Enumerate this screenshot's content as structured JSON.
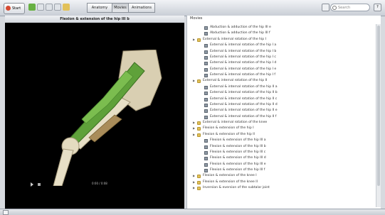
{
  "toolbar": {
    "start_label": "Start",
    "tabs": [
      {
        "label": "Anatomy",
        "active": false
      },
      {
        "label": "Movies",
        "active": true
      },
      {
        "label": "Animations",
        "active": false
      }
    ],
    "search_placeholder": "Search",
    "right_button": "?"
  },
  "left": {
    "title": "Flexion & extension of the hip III b",
    "video_time": "0:00 / 0:08"
  },
  "right": {
    "title": "Movies",
    "items": [
      {
        "label": "Abduction & adduction of the hip III e",
        "type": "item",
        "level": 1
      },
      {
        "label": "Abduction & adduction of the hip III f",
        "type": "item",
        "level": 1
      },
      {
        "label": "External & internal rotation of the hip I",
        "type": "folder",
        "level": 0
      },
      {
        "label": "External & internal rotation of the hip I a",
        "type": "item",
        "level": 1
      },
      {
        "label": "External & internal rotation of the hip I b",
        "type": "item",
        "level": 1
      },
      {
        "label": "External & internal rotation of the hip I c",
        "type": "item",
        "level": 1
      },
      {
        "label": "External & internal rotation of the hip I d",
        "type": "item",
        "level": 1
      },
      {
        "label": "External & internal rotation of the hip I e",
        "type": "item",
        "level": 1
      },
      {
        "label": "External & internal rotation of the hip I f",
        "type": "item",
        "level": 1
      },
      {
        "label": "External & internal rotation of the hip II",
        "type": "folder",
        "level": 0
      },
      {
        "label": "External & internal rotation of the hip II a",
        "type": "item",
        "level": 1
      },
      {
        "label": "External & internal rotation of the hip II b",
        "type": "item",
        "level": 1
      },
      {
        "label": "External & internal rotation of the hip II c",
        "type": "item",
        "level": 1
      },
      {
        "label": "External & internal rotation of the hip II d",
        "type": "item",
        "level": 1
      },
      {
        "label": "External & internal rotation of the hip II e",
        "type": "item",
        "level": 1
      },
      {
        "label": "External & internal rotation of the hip II f",
        "type": "item",
        "level": 1
      },
      {
        "label": "External & internal rotation of the knee",
        "type": "folder",
        "level": 0
      },
      {
        "label": "Flexion & extension of the hip I",
        "type": "folder",
        "level": 0
      },
      {
        "label": "Flexion & extension of the hip II",
        "type": "folder",
        "level": 0
      },
      {
        "label": "Flexion & extension of the hip III a",
        "type": "item",
        "level": 1
      },
      {
        "label": "Flexion & extension of the hip III b",
        "type": "item",
        "level": 1
      },
      {
        "label": "Flexion & extension of the hip III c",
        "type": "item",
        "level": 1
      },
      {
        "label": "Flexion & extension of the hip III d",
        "type": "item",
        "level": 1
      },
      {
        "label": "Flexion & extension of the hip III e",
        "type": "item",
        "level": 1
      },
      {
        "label": "Flexion & extension of the hip III f",
        "type": "item",
        "level": 1
      },
      {
        "label": "Flexion & extension of the knee I",
        "type": "folder",
        "level": 0
      },
      {
        "label": "Flexion & extension of the knee II",
        "type": "folder",
        "level": 0
      },
      {
        "label": "Inversion & eversion of the subtalar joint",
        "type": "folder",
        "level": 0
      }
    ]
  }
}
